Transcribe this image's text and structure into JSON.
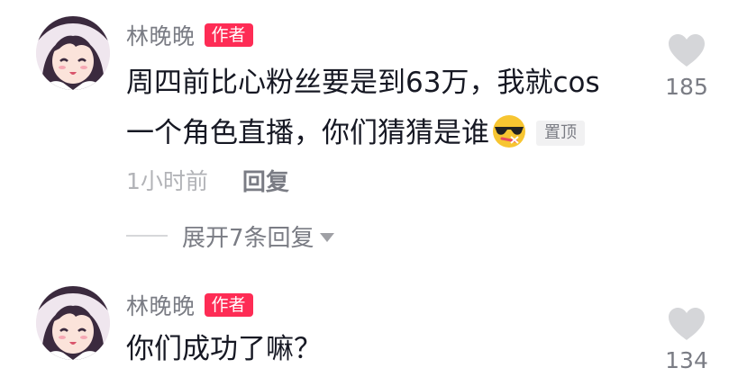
{
  "colors": {
    "author_badge": "#fe2c55",
    "text_primary": "#161823",
    "text_secondary": "#7a7c84",
    "text_tertiary": "#b2b3b7",
    "heart_icon": "#d5d6d9"
  },
  "comments": [
    {
      "avatar_icon": "anime-girl-avatar",
      "author": "林晚晚",
      "author_badge": "作者",
      "text_lines": [
        "周四前比心粉丝要是到63万，我就cos",
        "一个角色直播，你们猜猜是谁"
      ],
      "emoji_icon": "sunglasses-emoji",
      "pin_badge": "置顶",
      "time": "1小时前",
      "reply_label": "回复",
      "expand_replies_label": "展开7条回复",
      "like_icon": "heart-icon",
      "like_count": "185"
    },
    {
      "avatar_icon": "anime-girl-avatar",
      "author": "林晚晚",
      "author_badge": "作者",
      "text_lines": [
        "你们成功了嘛？"
      ],
      "like_icon": "heart-icon",
      "like_count": "134"
    }
  ]
}
